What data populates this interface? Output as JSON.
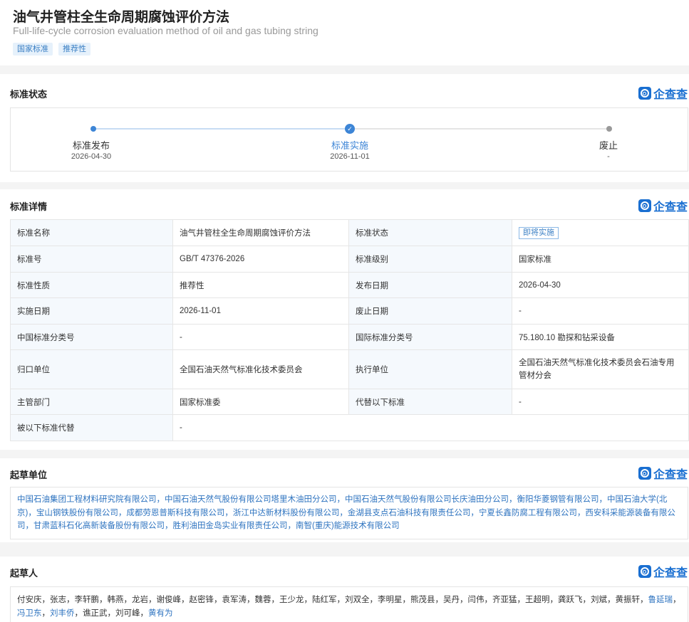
{
  "header": {
    "title": "油气井管柱全生命周期腐蚀评价方法",
    "subtitle": "Full-life-cycle corrosion evaluation method of oil and gas tubing string",
    "tags": [
      "国家标准",
      "推荐性"
    ]
  },
  "brand": {
    "name": "企查查"
  },
  "status_section": {
    "title": "标准状态",
    "steps": [
      {
        "label": "标准发布",
        "date": "2026-04-30"
      },
      {
        "label": "标准实施",
        "date": "2026-11-01"
      },
      {
        "label": "废止",
        "date": "-"
      }
    ]
  },
  "detail_section": {
    "title": "标准详情",
    "rows": [
      [
        "标准名称",
        "油气井管柱全生命周期腐蚀评价方法",
        "标准状态",
        "即将实施"
      ],
      [
        "标准号",
        "GB/T 47376-2026",
        "标准级别",
        "国家标准"
      ],
      [
        "标准性质",
        "推荐性",
        "发布日期",
        "2026-04-30"
      ],
      [
        "实施日期",
        "2026-11-01",
        "废止日期",
        "-"
      ],
      [
        "中国标准分类号",
        "-",
        "国际标准分类号",
        "75.180.10 勘探和钻采设备"
      ],
      [
        "归口单位",
        "全国石油天然气标准化技术委员会",
        "执行单位",
        "全国石油天然气标准化技术委员会石油专用管材分会"
      ],
      [
        "主管部门",
        "国家标准委",
        "代替以下标准",
        "-"
      ],
      [
        "被以下标准代替",
        "-"
      ]
    ]
  },
  "units_section": {
    "title": "起草单位",
    "units": [
      "中国石油集团工程材料研究院有限公司",
      "中国石油天然气股份有限公司塔里木油田分公司",
      "中国石油天然气股份有限公司长庆油田分公司",
      "衡阳华菱钢管有限公司",
      "中国石油大学(北京)",
      "宝山钢铁股份有限公司",
      "成都劳恩普斯科技有限公司",
      "浙江中达新材料股份有限公司",
      "金湖县支点石油科技有限责任公司",
      "宁夏长鑫防腐工程有限公司",
      "西安科采能源装备有限公司",
      "甘肃蓝科石化高新装备股份有限公司",
      "胜利油田金岛实业有限责任公司",
      "南智(重庆)能源技术有限公司"
    ]
  },
  "people_section": {
    "title": "起草人",
    "people": [
      {
        "name": "付安庆",
        "link": false
      },
      {
        "name": "张志",
        "link": false
      },
      {
        "name": "李轩鹏",
        "link": false
      },
      {
        "name": "韩燕",
        "link": false
      },
      {
        "name": "龙岩",
        "link": false
      },
      {
        "name": "谢俊峰",
        "link": false
      },
      {
        "name": "赵密锋",
        "link": false
      },
      {
        "name": "袁军涛",
        "link": false
      },
      {
        "name": "魏蓉",
        "link": false
      },
      {
        "name": "王少龙",
        "link": false
      },
      {
        "name": "陆红军",
        "link": false
      },
      {
        "name": "刘双全",
        "link": false
      },
      {
        "name": "李明星",
        "link": false
      },
      {
        "name": "熊茂县",
        "link": false
      },
      {
        "name": "吴丹",
        "link": false
      },
      {
        "name": "闫伟",
        "link": false
      },
      {
        "name": "齐亚猛",
        "link": false
      },
      {
        "name": "王超明",
        "link": false
      },
      {
        "name": "龚跃飞",
        "link": false
      },
      {
        "name": "刘斌",
        "link": false
      },
      {
        "name": "黄振轩",
        "link": false
      },
      {
        "name": "鲁延瑞",
        "link": true
      },
      {
        "name": "冯卫东",
        "link": true
      },
      {
        "name": "刘丰侨",
        "link": true
      },
      {
        "name": "谯正武",
        "link": false
      },
      {
        "name": "刘可峰",
        "link": false
      },
      {
        "name": "黄有为",
        "link": true
      }
    ]
  }
}
